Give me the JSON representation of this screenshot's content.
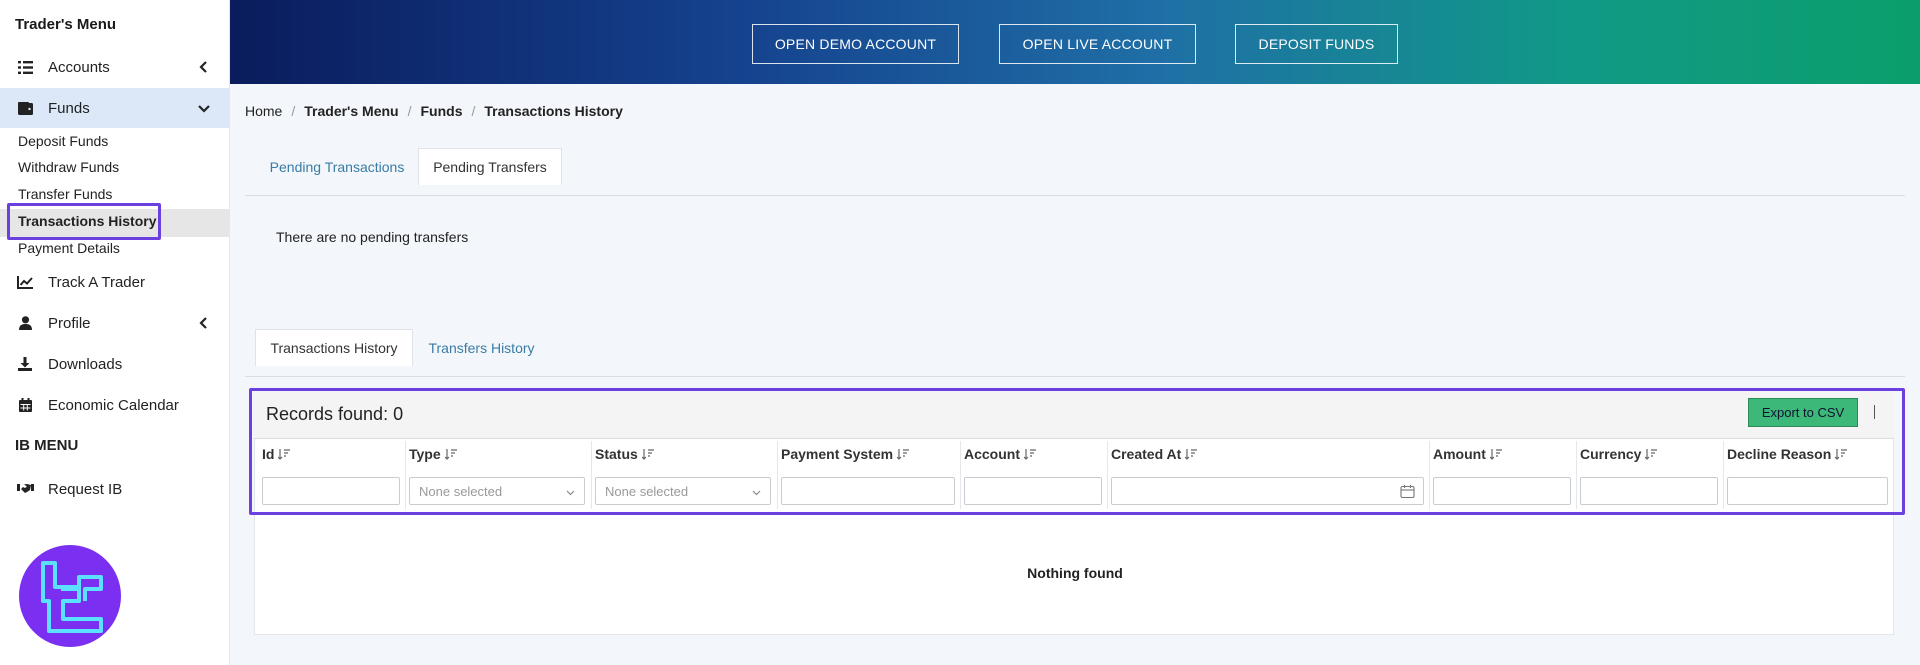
{
  "sidebar": {
    "title": "Trader's Menu",
    "items": [
      {
        "label": "Accounts"
      },
      {
        "label": "Funds"
      },
      {
        "label": "Track A Trader"
      },
      {
        "label": "Profile"
      },
      {
        "label": "Downloads"
      },
      {
        "label": "Economic Calendar"
      }
    ],
    "funds_sub": [
      "Deposit Funds",
      "Withdraw Funds",
      "Transfer Funds",
      "Transactions History",
      "Payment Details"
    ],
    "ib_title": "IB MENU",
    "ib_items": [
      {
        "label": "Request IB"
      }
    ]
  },
  "banner": {
    "demo": "OPEN DEMO ACCOUNT",
    "live": "OPEN LIVE ACCOUNT",
    "deposit": "DEPOSIT FUNDS"
  },
  "breadcrumb": [
    "Home",
    "Trader's Menu",
    "Funds",
    "Transactions History"
  ],
  "pending": {
    "tabs": [
      "Pending Transactions",
      "Pending Transfers"
    ],
    "active_tab": "Pending Transfers",
    "message": "There are no pending transfers"
  },
  "history": {
    "tabs": [
      "Transactions History",
      "Transfers History"
    ],
    "active_tab": "Transactions History",
    "records_label": "Records found: 0",
    "export_label": "Export to CSV",
    "columns": [
      "Id",
      "Type",
      "Status",
      "Payment System",
      "Account",
      "Created At",
      "Amount",
      "Currency",
      "Decline Reason"
    ],
    "select_placeholder": "None selected",
    "empty_message": "Nothing found"
  },
  "colors": {
    "accent": "#6c3fe0",
    "link": "#3a7ca5",
    "export": "#3cb878"
  }
}
